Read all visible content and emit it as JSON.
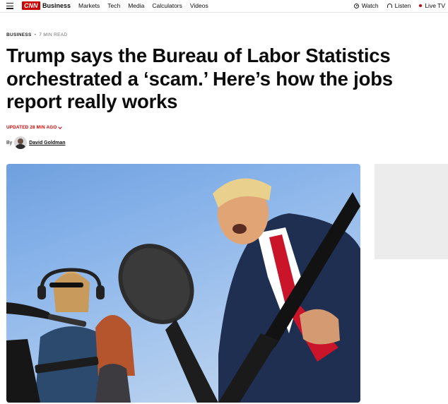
{
  "nav": {
    "brand": "CNN",
    "section": "Business",
    "links": [
      "Markets",
      "Tech",
      "Media",
      "Calculators",
      "Videos"
    ],
    "watch": "Watch",
    "listen": "Listen",
    "live": "Live TV",
    "icons": {
      "menu": "hamburger-icon",
      "watch": "play-circle-icon",
      "listen": "headphones-icon",
      "live": "live-dot-icon"
    },
    "colors": {
      "brand_red": "#cc0000"
    }
  },
  "article": {
    "category": "BUSINESS",
    "separator": "•",
    "read_time": "7 MIN READ",
    "headline": "Trump says the Bureau of Labor Statistics orchestrated a ‘scam.’ Here’s how the jobs report really works",
    "updated": "UPDATED 28 MIN AGO",
    "by": "By",
    "author": "David Goldman"
  }
}
